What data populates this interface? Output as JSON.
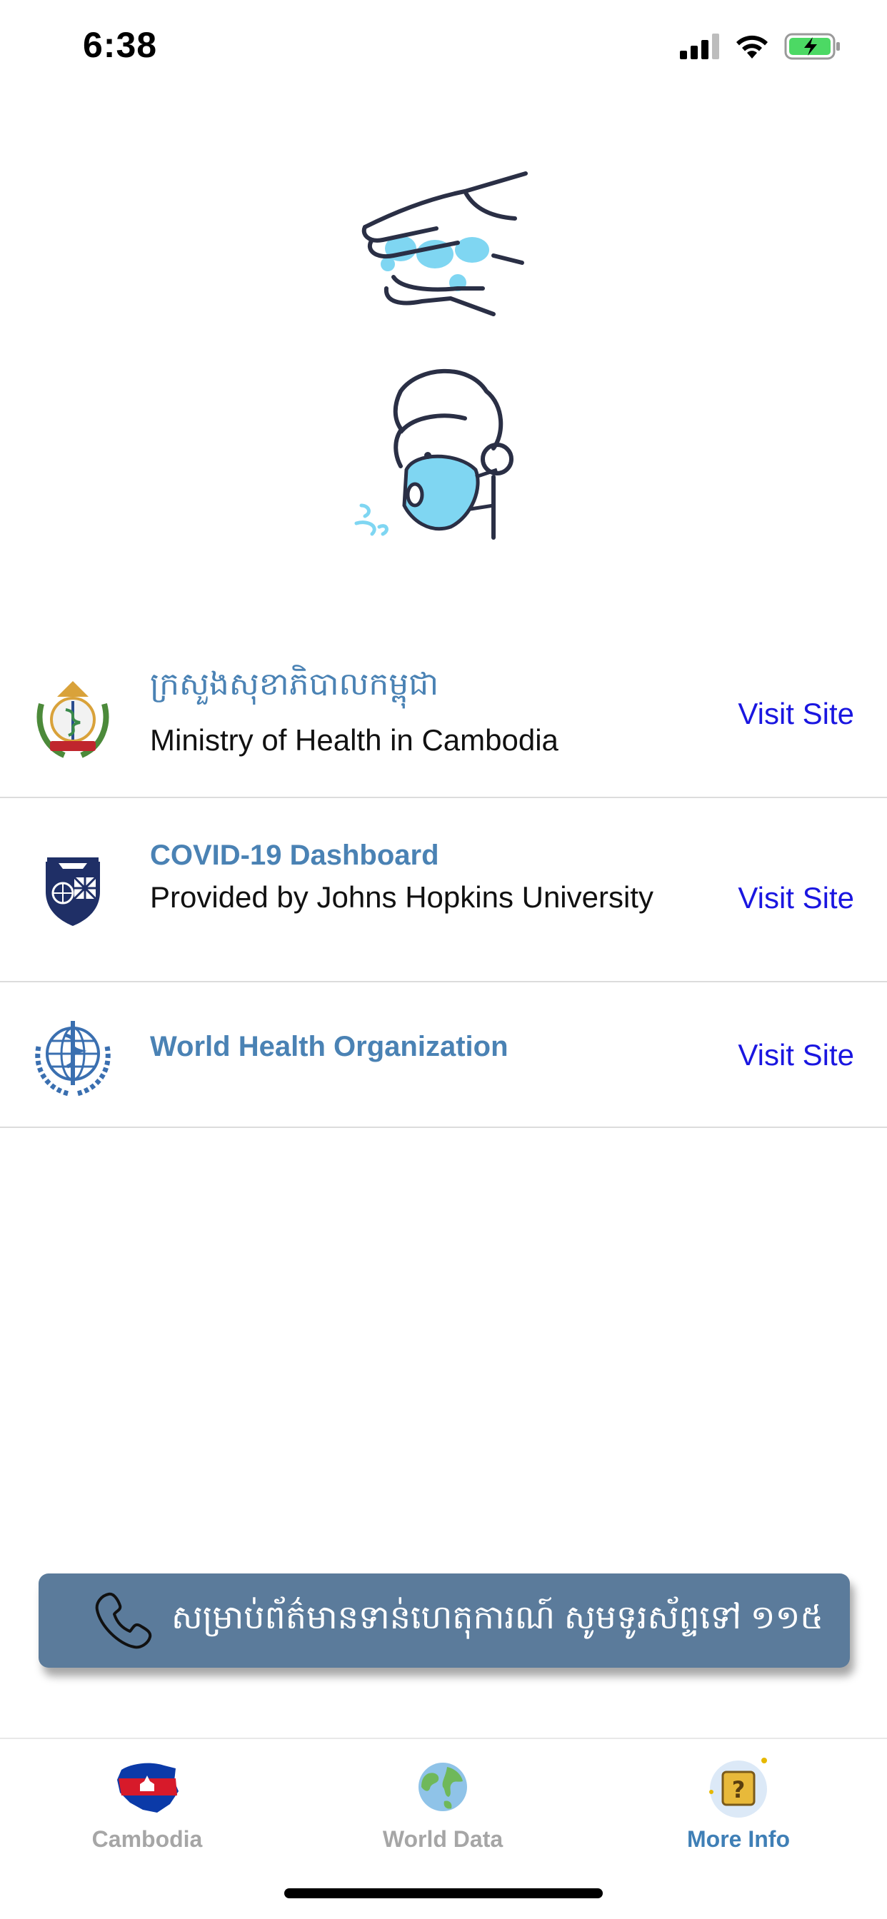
{
  "status_bar": {
    "time": "6:38",
    "icons": [
      "signal-icon",
      "wifi-icon",
      "battery-charging-icon"
    ],
    "battery_color": "#4cd964"
  },
  "illustrations": [
    "hand-washing-icon",
    "face-mask-icon"
  ],
  "links": [
    {
      "logo": "ministry-of-health-emblem-icon",
      "title": "ក្រសួងសុខាភិបាលកម្ពុជា",
      "subtitle": "Ministry of Health in Cambodia",
      "action": "Visit Site"
    },
    {
      "logo": "johns-hopkins-shield-icon",
      "title": "COVID-19 Dashboard",
      "subtitle": "Provided by Johns Hopkins University",
      "action": "Visit Site"
    },
    {
      "logo": "who-emblem-icon",
      "title": "World Health Organization",
      "subtitle": "",
      "action": "Visit Site"
    }
  ],
  "hotline": {
    "icon": "phone-icon",
    "text": "សម្រាប់ព័ត៌មានទាន់ហេតុការណ៍ សូមទូរស័ព្ទទៅ ១១៥",
    "background": "#5b7b9b"
  },
  "tabbar": {
    "tabs": [
      {
        "label": "Cambodia",
        "icon": "cambodia-map-flag-icon",
        "active": false
      },
      {
        "label": "World Data",
        "icon": "globe-icon",
        "active": false
      },
      {
        "label": "More Info",
        "icon": "question-box-icon",
        "active": true
      }
    ],
    "active_color": "#3f7fb6",
    "inactive_color": "#a6a6a6"
  },
  "colors": {
    "title_blue": "#4a82b4",
    "link_blue": "#1a16e0"
  }
}
